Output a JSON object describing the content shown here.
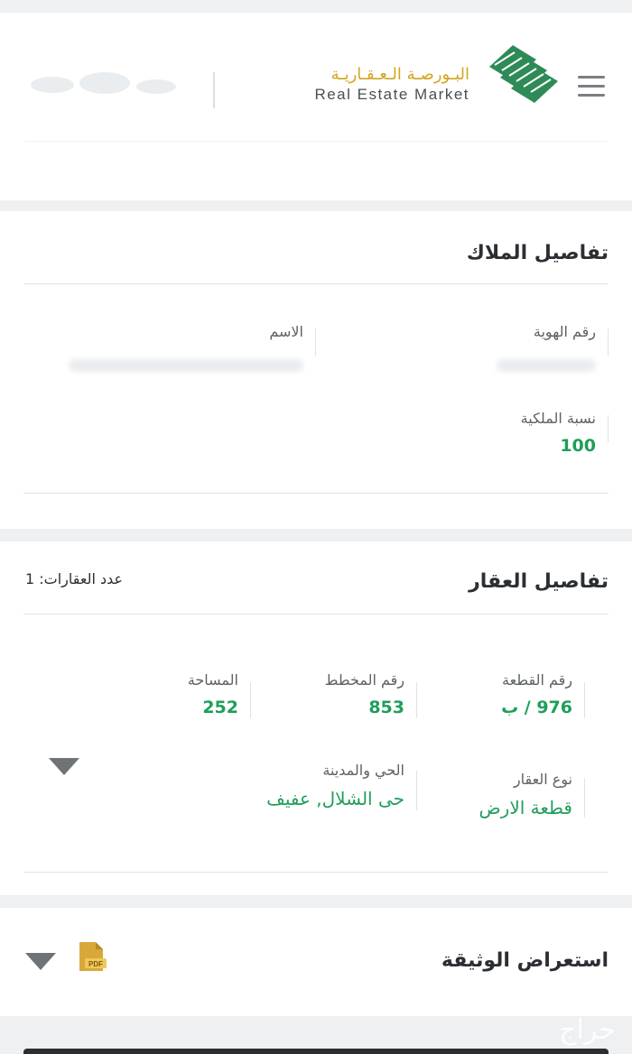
{
  "header": {
    "brand_ar": "البـورصـة الـعـقـاريـة",
    "brand_en": "Real Estate Market",
    "colors": {
      "brand_gold": "#d4a520",
      "brand_green": "#2e8b57",
      "value_green": "#1e9e5a"
    }
  },
  "owner_section": {
    "title": "تفاصيل الملاك",
    "id_label": "رقم الهوية",
    "name_label": "الاسم",
    "share_label": "نسبة الملكية",
    "share_value": "100"
  },
  "property_section": {
    "title": "تفاصيل العقار",
    "count_text": "عدد العقارات: 1",
    "plot_number_label": "رقم القطعة",
    "plot_number_value": "976 / ب",
    "scheme_number_label": "رقم المخطط",
    "scheme_number_value": "853",
    "area_label": "المساحة",
    "area_value": "252",
    "property_type_label": "نوع العقار",
    "property_type_value": "قطعة الارض",
    "district_city_label": "الحي والمدينة",
    "district_city_value": "حى الشلال, عفيف"
  },
  "document_section": {
    "title": "استعراض الوثيقة",
    "pdf_badge": "PDF"
  },
  "watermark": "حراج"
}
